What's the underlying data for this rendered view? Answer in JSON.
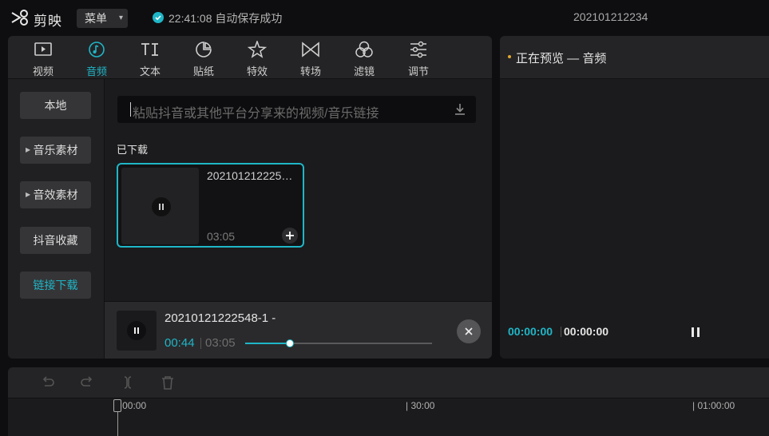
{
  "app": {
    "name": "剪映",
    "menu_label": "菜单",
    "save_status": "22:41:08 自动保存成功",
    "project_title": "202101212234"
  },
  "toolbar": {
    "tabs": [
      {
        "label": "视频",
        "icon": "video-icon"
      },
      {
        "label": "音频",
        "icon": "audio-icon",
        "active": true
      },
      {
        "label": "文本",
        "icon": "text-icon"
      },
      {
        "label": "贴纸",
        "icon": "sticker-icon"
      },
      {
        "label": "特效",
        "icon": "effects-icon"
      },
      {
        "label": "转场",
        "icon": "transition-icon"
      },
      {
        "label": "滤镜",
        "icon": "filter-icon"
      },
      {
        "label": "调节",
        "icon": "adjust-icon"
      }
    ]
  },
  "left_nav": {
    "items": [
      {
        "label": "本地"
      },
      {
        "label": "音乐素材",
        "expandable": true
      },
      {
        "label": "音效素材",
        "expandable": true
      },
      {
        "label": "抖音收藏"
      },
      {
        "label": "链接下载",
        "active": true
      }
    ]
  },
  "link_download": {
    "placeholder": "粘贴抖音或其他平台分享来的视频/音乐链接",
    "section_label": "已下载"
  },
  "downloaded_items": [
    {
      "title": "202101212225…",
      "duration": "03:05"
    }
  ],
  "player": {
    "title": "20210121222548-1 -",
    "elapsed": "00:44",
    "total": "03:05",
    "progress": 0.237
  },
  "preview": {
    "title": "正在预览 — 音频",
    "current_time": "00:00:00",
    "total_time": "00:00:00"
  },
  "timeline": {
    "ticks": [
      "|00:00",
      "| 30:00",
      "| 01:00:00"
    ]
  },
  "colors": {
    "accent": "#1fb6c7",
    "background": "#0e0e10",
    "panel": "#1b1b1d",
    "status_dot": "#e0a82e"
  }
}
